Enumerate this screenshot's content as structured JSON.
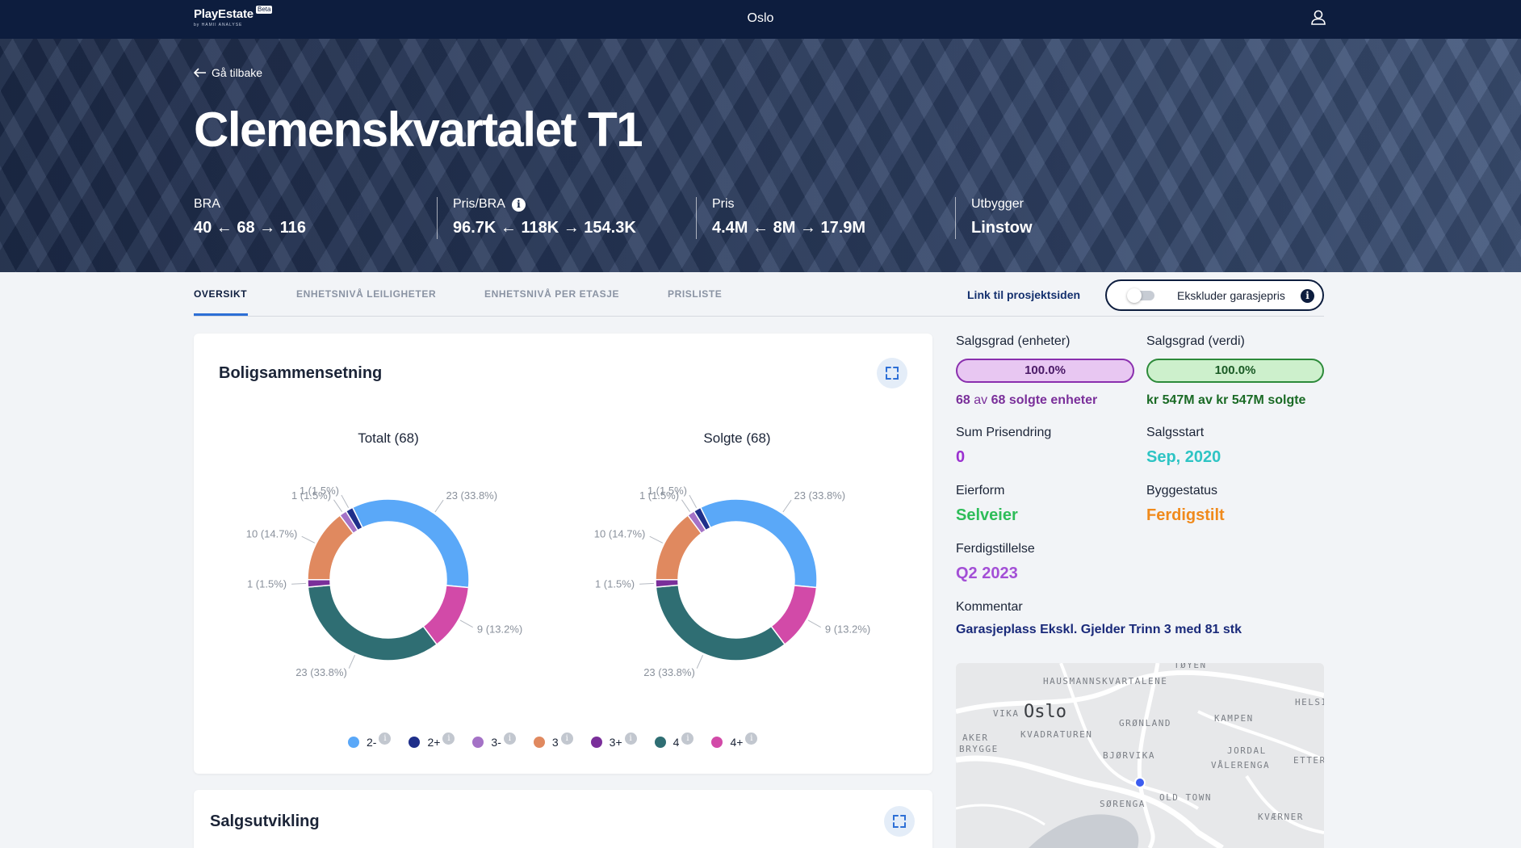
{
  "app": {
    "logo": "PlayEstate",
    "beta": "Beta",
    "logo_sub": "by HAMII ANALYSE",
    "city": "Oslo"
  },
  "hero": {
    "back_label": "Gå tilbake",
    "title": "Clemenskvartalet T1",
    "stats": [
      {
        "label": "BRA",
        "value": "40 ← 68 → 116"
      },
      {
        "label": "Pris/BRA",
        "value": "96.7K ← 118K → 154.3K"
      },
      {
        "label": "Pris",
        "value": "4.4M ← 8M → 17.9M"
      },
      {
        "label": "Utbygger",
        "value": "Linstow"
      }
    ]
  },
  "tabs": [
    {
      "label": "OVERSIKT",
      "active": true
    },
    {
      "label": "ENHETSNIVÅ LEILIGHETER",
      "active": false
    },
    {
      "label": "ENHETSNIVÅ PER ETASJE",
      "active": false
    },
    {
      "label": "PRISLISTE",
      "active": false
    }
  ],
  "toolbar": {
    "project_link": "Link til prosjektsiden",
    "toggle_label": "Ekskluder garasjepris",
    "toggle_on": false
  },
  "composition_card": {
    "title": "Boligsammensetning"
  },
  "sales_card": {
    "title": "Salgsutvikling"
  },
  "chart_data": [
    {
      "type": "pie",
      "title": "Totalt (68)",
      "categories": [
        "2-",
        "2+",
        "3-",
        "3",
        "3+",
        "4",
        "4+"
      ],
      "values": [
        23,
        1,
        1,
        10,
        1,
        23,
        9
      ],
      "labels": [
        "23 (33.8%)",
        "1 (1.5%)",
        "1 (1.5%)",
        "10 (14.7%)",
        "1 (1.5%)",
        "23 (33.8%)",
        "9 (13.2%)"
      ],
      "colors": [
        "#5aa8f8",
        "#1f2f8a",
        "#a472c6",
        "#e0895f",
        "#7a2f9a",
        "#2f6e73",
        "#d24aa8"
      ],
      "legend": "bottom"
    },
    {
      "type": "pie",
      "title": "Solgte (68)",
      "categories": [
        "2-",
        "2+",
        "3-",
        "3",
        "3+",
        "4",
        "4+"
      ],
      "values": [
        23,
        1,
        1,
        10,
        1,
        23,
        9
      ],
      "labels": [
        "23 (33.8%)",
        "1 (1.5%)",
        "1 (1.5%)",
        "10 (14.7%)",
        "1 (1.5%)",
        "23 (33.8%)",
        "9 (13.2%)"
      ],
      "colors": [
        "#5aa8f8",
        "#1f2f8a",
        "#a472c6",
        "#e0895f",
        "#7a2f9a",
        "#2f6e73",
        "#d24aa8"
      ],
      "legend": "bottom"
    }
  ],
  "legend": [
    {
      "label": "2-",
      "color": "#5aa8f8"
    },
    {
      "label": "2+",
      "color": "#1f2f8a"
    },
    {
      "label": "3-",
      "color": "#a472c6"
    },
    {
      "label": "3",
      "color": "#e0895f"
    },
    {
      "label": "3+",
      "color": "#7a2f9a"
    },
    {
      "label": "4",
      "color": "#2f6e73"
    },
    {
      "label": "4+",
      "color": "#d24aa8"
    }
  ],
  "info": {
    "salgsgrad_enheter": {
      "label": "Salgsgrad (enheter)",
      "bar": "100.0%",
      "progress": 1.0,
      "sub_num1": "68",
      "sub_mid": " av ",
      "sub_num2": "68",
      "sub_tail": " solgte enheter"
    },
    "salgsgrad_verdi": {
      "label": "Salgsgrad (verdi)",
      "bar": "100.0%",
      "progress": 1.0,
      "sub": "kr 547M av kr 547M solgte"
    },
    "sum_prisendring": {
      "label": "Sum Prisendring",
      "value": "0"
    },
    "salgsstart": {
      "label": "Salgsstart",
      "value": "Sep, 2020"
    },
    "eierform": {
      "label": "Eierform",
      "value": "Selveier"
    },
    "byggestatus": {
      "label": "Byggestatus",
      "value": "Ferdigstilt"
    },
    "ferdigstillelse": {
      "label": "Ferdigstillelse",
      "value": "Q2 2023"
    },
    "kommentar": {
      "label": "Kommentar",
      "value": "Garasjeplass Ekskl. Gjelder Trinn 3 med 81 stk"
    }
  },
  "map": {
    "city": "Oslo",
    "labels": [
      "TØYEN",
      "HAUSMANNSKVARTALENE",
      "HELSI",
      "VIKA",
      "GRØNLAND",
      "KAMPEN",
      "AKER",
      "BRYGGE",
      "KVADRATUREN",
      "BJØRVIKA",
      "JORDAL",
      "VÅLERENGA",
      "ETTER",
      "SØRENGA",
      "OLD TOWN",
      "KVÆRNER"
    ]
  },
  "colors": {
    "accent": "#2d6fd6",
    "navy": "#0d1d3e",
    "purple": "#9b30d0",
    "green": "#2ebd59",
    "orange": "#f08a1c",
    "teal": "#2ec4c4"
  }
}
